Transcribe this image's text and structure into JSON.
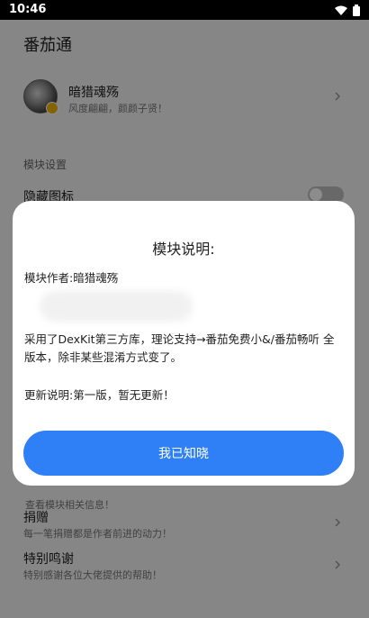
{
  "status": {
    "time": "10:46"
  },
  "app": {
    "title": "番茄通",
    "profile": {
      "name": "暗猎魂殇",
      "motto": "风度翩翩，颜颜子贤！"
    },
    "section_label": "模块设置",
    "hide_icon_label": "隐藏图标",
    "behind_row_sub": "查看模块相关信息！",
    "donate": {
      "title": "捐赠",
      "sub": "每一笔捐赠都是作者前进的动力！"
    },
    "thanks": {
      "title": "特别鸣谢",
      "sub": "特别感谢各位大佬提供的帮助！"
    }
  },
  "dialog": {
    "title": "模块说明:",
    "author": "模块作者:暗猎魂殇",
    "desc": "采用了DexKit第三方库，理论支持→番茄免费小&/番茄畅听 全版本，除非某些混淆方式变了。",
    "changelog": "更新说明:第一版，暂无更新！",
    "confirm": "我已知晓"
  },
  "colors": {
    "accent": "#2f80f6",
    "scrim": "rgba(0,0,0,0.45)"
  }
}
